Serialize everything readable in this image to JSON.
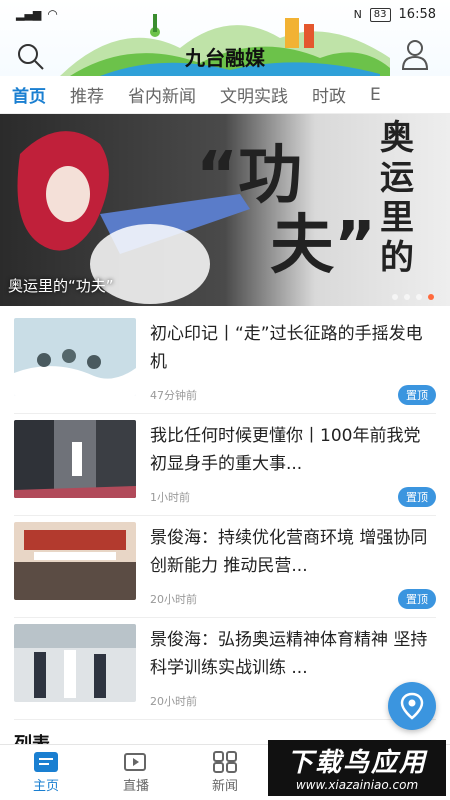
{
  "status_bar": {
    "battery": "83",
    "time": "16:58"
  },
  "header": {
    "app_title": "九台融媒"
  },
  "tabs": [
    "首页",
    "推荐",
    "省内新闻",
    "文明实践",
    "时政",
    "E"
  ],
  "banner": {
    "caption": "奥运里的“功夫”",
    "headline_chars": [
      "奥",
      "运",
      "里",
      "的"
    ],
    "big_chars": [
      "“",
      "功",
      "夫",
      "”"
    ]
  },
  "news": [
    {
      "title": "初心印记丨“走”过长征路的手摇发电机",
      "time": "47分钟前",
      "badge": "置顶"
    },
    {
      "title": "我比任何时候更懂你丨100年前我党初显身手的重大事...",
      "time": "1小时前",
      "badge": "置顶"
    },
    {
      "title": "景俊海：持续优化营商环境 增强协同创新能力 推动民营...",
      "time": "20小时前",
      "badge": "置顶"
    },
    {
      "title": "景俊海：弘扬奥运精神体育精神 坚持科学训练实战训练 ...",
      "time": "20小时前",
      "badge": ""
    }
  ],
  "section_heading": "列表",
  "bottom_nav": [
    {
      "label": "主页",
      "icon": "home-icon"
    },
    {
      "label": "直播",
      "icon": "live-icon"
    },
    {
      "label": "新闻",
      "icon": "news-grid-icon"
    }
  ],
  "watermark": {
    "line1": "下载鸟应用",
    "line2": "www.xiazainiao.com"
  },
  "colors": {
    "accent": "#1a7fd1",
    "badge": "#3b95df",
    "dot_active": "#ff6a3d"
  }
}
